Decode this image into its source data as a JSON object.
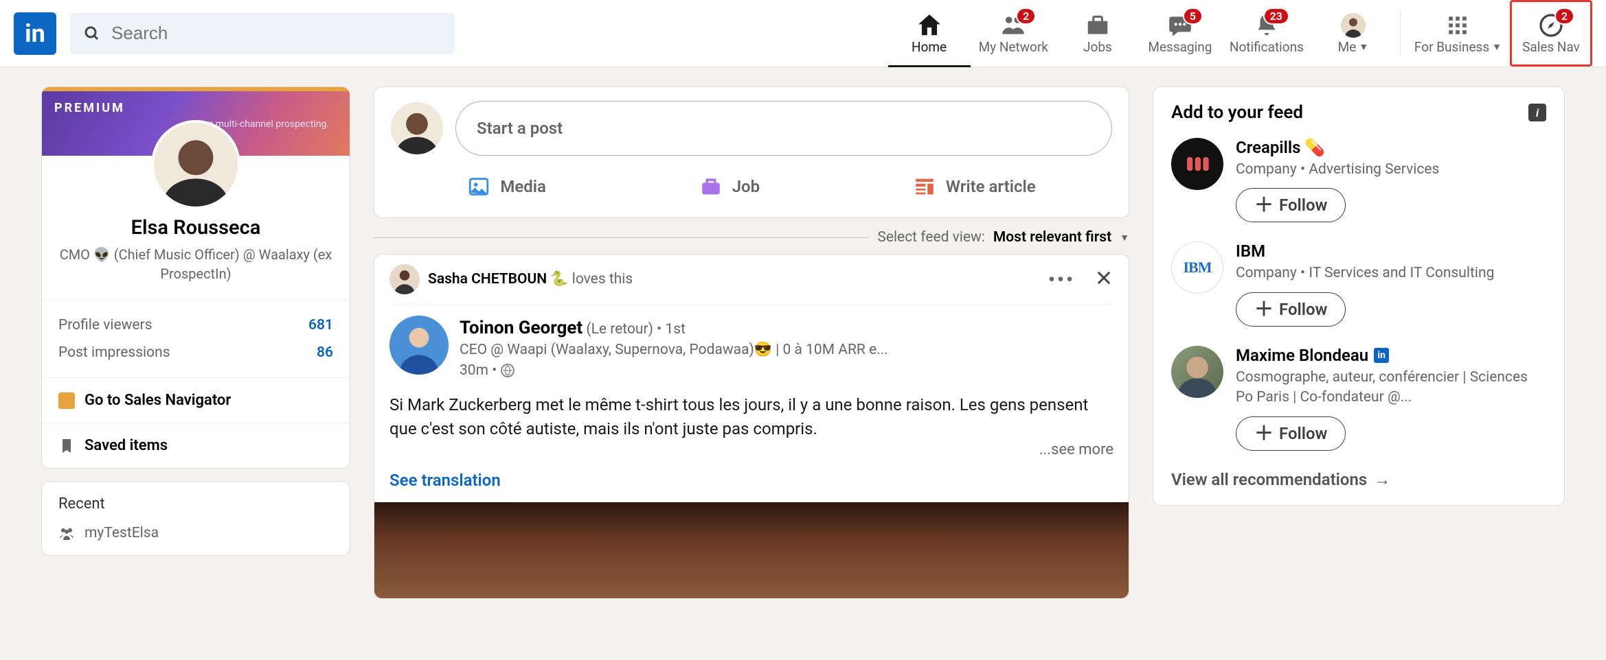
{
  "header": {
    "search_placeholder": "Search",
    "nav": {
      "home": "Home",
      "network": "My Network",
      "network_badge": "2",
      "jobs": "Jobs",
      "messaging": "Messaging",
      "messaging_badge": "5",
      "notifications": "Notifications",
      "notifications_badge": "23",
      "me": "Me",
      "business": "For Business",
      "sales": "Sales Nav",
      "sales_badge": "2"
    }
  },
  "left": {
    "premium_tag": "PREMIUM",
    "banner_tagline": "Your multi-channel prospecting.",
    "name": "Elsa Rousseca",
    "title": "CMO 👽 (Chief Music Officer) @ Waalaxy (ex ProspectIn)",
    "stats": {
      "viewers_label": "Profile viewers",
      "viewers_value": "681",
      "impressions_label": "Post impressions",
      "impressions_value": "86"
    },
    "sales_nav_link": "Go to Sales Navigator",
    "saved_link": "Saved items",
    "recent_title": "Recent",
    "recent_item_1": "myTestElsa"
  },
  "center": {
    "start_post": "Start a post",
    "action_media": "Media",
    "action_job": "Job",
    "action_article": "Write article",
    "feed_select_label": "Select feed view:",
    "feed_select_value": "Most relevant first",
    "feed": {
      "reactor_name": "Sasha CHETBOUN 🐍",
      "reactor_action": "loves this",
      "author_name": "Toinon Georget",
      "author_suffix": "(Le retour)",
      "author_degree": "1st",
      "author_headline": "CEO @ Waapi (Waalaxy, Supernova, Podawaa)😎 | 0 à 10M ARR e...",
      "post_time": "30m",
      "post_text": "Si Mark Zuckerberg met le même t-shirt tous les jours, il y a une bonne raison. Les gens pensent que c'est son côté autiste, mais ils n'ont juste pas compris.",
      "see_more": "...see more",
      "see_translation": "See translation"
    }
  },
  "right": {
    "title": "Add to your feed",
    "follow_label": "Follow",
    "view_all": "View all recommendations",
    "suggestions": [
      {
        "name": "Creapills 💊",
        "desc": "Company • Advertising Services"
      },
      {
        "name": "IBM",
        "desc": "Company • IT Services and IT Consulting"
      },
      {
        "name": "Maxime Blondeau",
        "desc": "Cosmographe, auteur, conférencier | Sciences Po Paris | Co-fondateur @..."
      }
    ]
  }
}
